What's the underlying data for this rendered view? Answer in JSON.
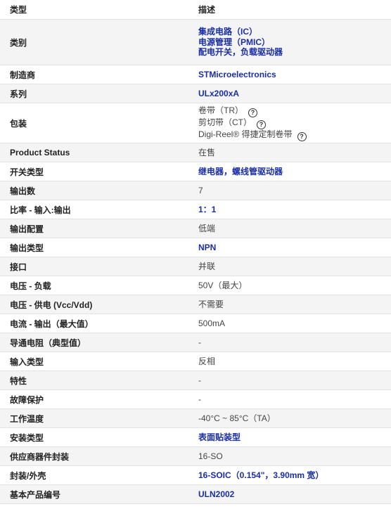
{
  "header": {
    "type_label": "类型",
    "desc_label": "描述"
  },
  "rows": [
    {
      "label": "类别",
      "values": [
        "集成电路（IC）",
        "电源管理（PMIC）",
        "配电开关，负载驱动器"
      ],
      "style": "link"
    },
    {
      "label": "制造商",
      "values": [
        "STMicroelectronics"
      ],
      "style": "link"
    },
    {
      "label": "系列",
      "values": [
        "ULx200xA"
      ],
      "style": "link"
    },
    {
      "label": "包装",
      "values": [
        "卷带（TR）",
        "剪切带（CT）",
        "Digi-Reel® 得捷定制卷带"
      ],
      "style": "plain",
      "help": true
    },
    {
      "label": "Product Status",
      "values": [
        "在售"
      ],
      "style": "plain"
    },
    {
      "label": "开关类型",
      "values": [
        "继电器，螺线管驱动器"
      ],
      "style": "link"
    },
    {
      "label": "输出数",
      "values": [
        "7"
      ],
      "style": "plain"
    },
    {
      "label": "比率 - 输入:输出",
      "values": [
        "1：1"
      ],
      "style": "link"
    },
    {
      "label": "输出配置",
      "values": [
        "低端"
      ],
      "style": "plain"
    },
    {
      "label": "输出类型",
      "values": [
        "NPN"
      ],
      "style": "link"
    },
    {
      "label": "接口",
      "values": [
        "并联"
      ],
      "style": "plain"
    },
    {
      "label": "电压 - 负载",
      "values": [
        "50V（最大）"
      ],
      "style": "plain"
    },
    {
      "label": "电压 - 供电 (Vcc/Vdd)",
      "values": [
        "不需要"
      ],
      "style": "plain"
    },
    {
      "label": "电流 - 输出（最大值）",
      "values": [
        "500mA"
      ],
      "style": "plain"
    },
    {
      "label": "导通电阻（典型值）",
      "values": [
        "-"
      ],
      "style": "plain"
    },
    {
      "label": "输入类型",
      "values": [
        "反相"
      ],
      "style": "plain"
    },
    {
      "label": "特性",
      "values": [
        "-"
      ],
      "style": "plain"
    },
    {
      "label": "故障保护",
      "values": [
        "-"
      ],
      "style": "plain"
    },
    {
      "label": "工作温度",
      "values": [
        "-40°C ~ 85°C（TA）"
      ],
      "style": "plain"
    },
    {
      "label": "安装类型",
      "values": [
        "表面贴装型"
      ],
      "style": "link"
    },
    {
      "label": "供应商器件封装",
      "values": [
        "16-SO"
      ],
      "style": "plain"
    },
    {
      "label": "封装/外壳",
      "values": [
        "16-SOIC（0.154\"，3.90mm 宽）"
      ],
      "style": "link"
    },
    {
      "label": "基本产品编号",
      "values": [
        "ULN2002"
      ],
      "style": "link"
    }
  ],
  "help_icon": "question-circle-icon",
  "colors": {
    "link": "#1a2ea6",
    "stripe": "#f4f4f4",
    "border": "#e2e2e2"
  }
}
